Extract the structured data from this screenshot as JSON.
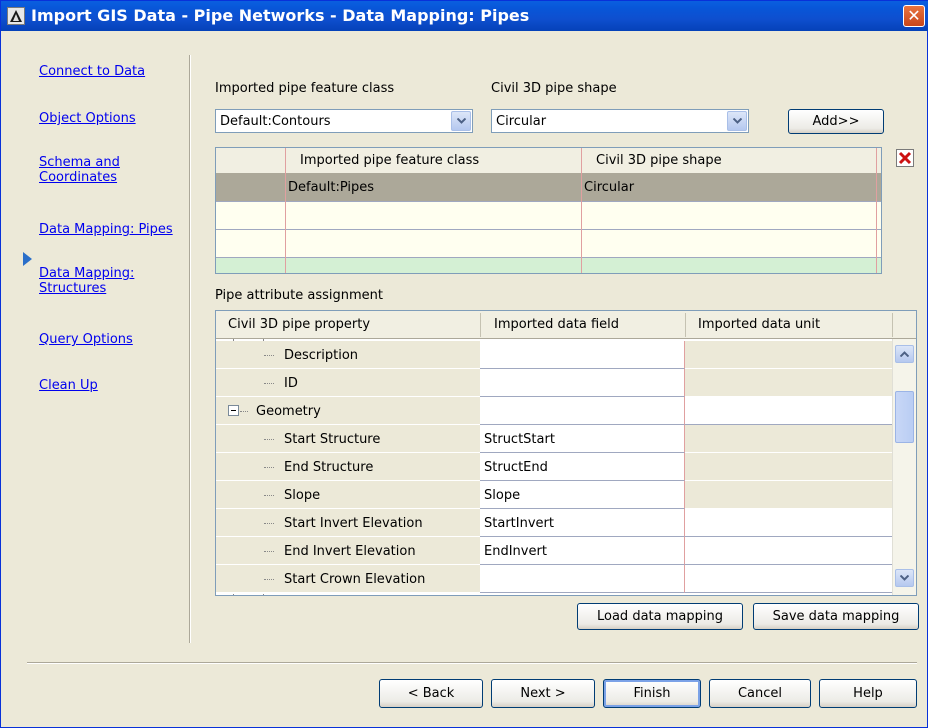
{
  "window": {
    "title": "Import GIS Data - Pipe Networks - Data Mapping: Pipes",
    "close_label": "✕"
  },
  "nav": {
    "items": [
      {
        "label": "Connect to Data",
        "current": false
      },
      {
        "label": "Object Options",
        "current": false
      },
      {
        "label": "Schema and Coordinates",
        "current": false
      },
      {
        "label": "Data Mapping: Pipes",
        "current": true
      },
      {
        "label": "Data Mapping: Structures",
        "current": false
      },
      {
        "label": "Query Options",
        "current": false
      },
      {
        "label": "Clean Up",
        "current": false
      }
    ]
  },
  "mapping": {
    "feature_class_label": "Imported pipe feature class",
    "feature_class_value": "Default:Contours",
    "pipe_shape_label": "Civil 3D pipe shape",
    "pipe_shape_value": "Circular",
    "add_button": "Add>>"
  },
  "mapping_grid": {
    "headers": [
      "Imported pipe feature class",
      "Civil 3D pipe shape"
    ],
    "rows": [
      {
        "feature_class": "Default:Pipes",
        "shape": "Circular",
        "selected": true
      },
      {
        "feature_class": "",
        "shape": "",
        "selected": false
      },
      {
        "feature_class": "",
        "shape": "",
        "selected": false
      }
    ]
  },
  "attribute": {
    "section_label": "Pipe attribute assignment",
    "headers": [
      "Civil 3D pipe property",
      "Imported data field",
      "Imported data unit"
    ],
    "rows": [
      {
        "property": "Description",
        "field": "",
        "unit": "",
        "level": 1,
        "unit_editable": false
      },
      {
        "property": "ID",
        "field": "",
        "unit": "",
        "level": 1,
        "unit_editable": false
      },
      {
        "property": "Geometry",
        "field": "",
        "unit": "",
        "level": 0,
        "unit_editable": true
      },
      {
        "property": "Start Structure",
        "field": "StructStart",
        "unit": "",
        "level": 1,
        "unit_editable": false
      },
      {
        "property": "End Structure",
        "field": "StructEnd",
        "unit": "",
        "level": 1,
        "unit_editable": false
      },
      {
        "property": "Slope",
        "field": "Slope",
        "unit": "",
        "level": 1,
        "unit_editable": false
      },
      {
        "property": "Start Invert Elevation",
        "field": "StartInvert",
        "unit": "",
        "level": 1,
        "unit_editable": true
      },
      {
        "property": "End Invert Elevation",
        "field": "EndInvert",
        "unit": "",
        "level": 1,
        "unit_editable": true
      },
      {
        "property": "Start Crown Elevation",
        "field": "",
        "unit": "",
        "level": 1,
        "unit_editable": true
      }
    ],
    "load_button": "Load data mapping",
    "save_button": "Save data mapping"
  },
  "footer": {
    "back": "< Back",
    "next": "Next >",
    "finish": "Finish",
    "cancel": "Cancel",
    "help": "Help"
  },
  "colors": {
    "titlebar": "#0a5fe0",
    "selected_row": "#aca899",
    "empty_row": "#fffff0",
    "link": "#0000ee",
    "current_arrow": "#2a6fc9"
  }
}
